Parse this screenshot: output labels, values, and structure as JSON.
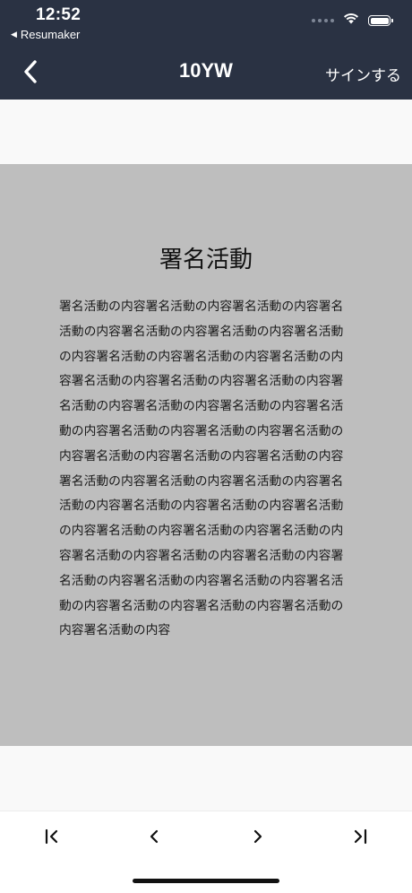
{
  "status_bar": {
    "time": "12:52",
    "back_app": "Resumaker",
    "icons": [
      "signal-dots-icon",
      "wifi-icon",
      "battery-icon"
    ]
  },
  "nav": {
    "title": "10YW",
    "back_icon": "chevron-left-icon",
    "sign_label": "サインする"
  },
  "document": {
    "title": "署名活動",
    "body": "署名活動の内容署名活動の内容署名活動の内容署名活動の内容署名活動の内容署名活動の内容署名活動の内容署名活動の内容署名活動の内容署名活動の内容署名活動の内容署名活動の内容署名活動の内容署名活動の内容署名活動の内容署名活動の内容署名活動の内容署名活動の内容署名活動の内容署名活動の内容署名活動の内容署名活動の内容署名活動の内容署名活動の内容署名活動の内容署名活動の内容署名活動の内容署名活動の内容署名活動の内容署名活動の内容署名活動の内容署名活動の内容署名活動の内容署名活動の内容署名活動の内容署名活動の内容署名活動の内容署名活動の内容署名活動の内容署名活動の内容署名活動の内容署名活動の内容署名活動の内容署名活動の内容"
  },
  "toolbar": {
    "items": [
      "first-page-icon",
      "previous-page-icon",
      "next-page-icon",
      "last-page-icon"
    ]
  },
  "colors": {
    "header_bg": "#2a3243",
    "page_bg": "#bebebe",
    "screen_bg": "#f9f9f9"
  }
}
